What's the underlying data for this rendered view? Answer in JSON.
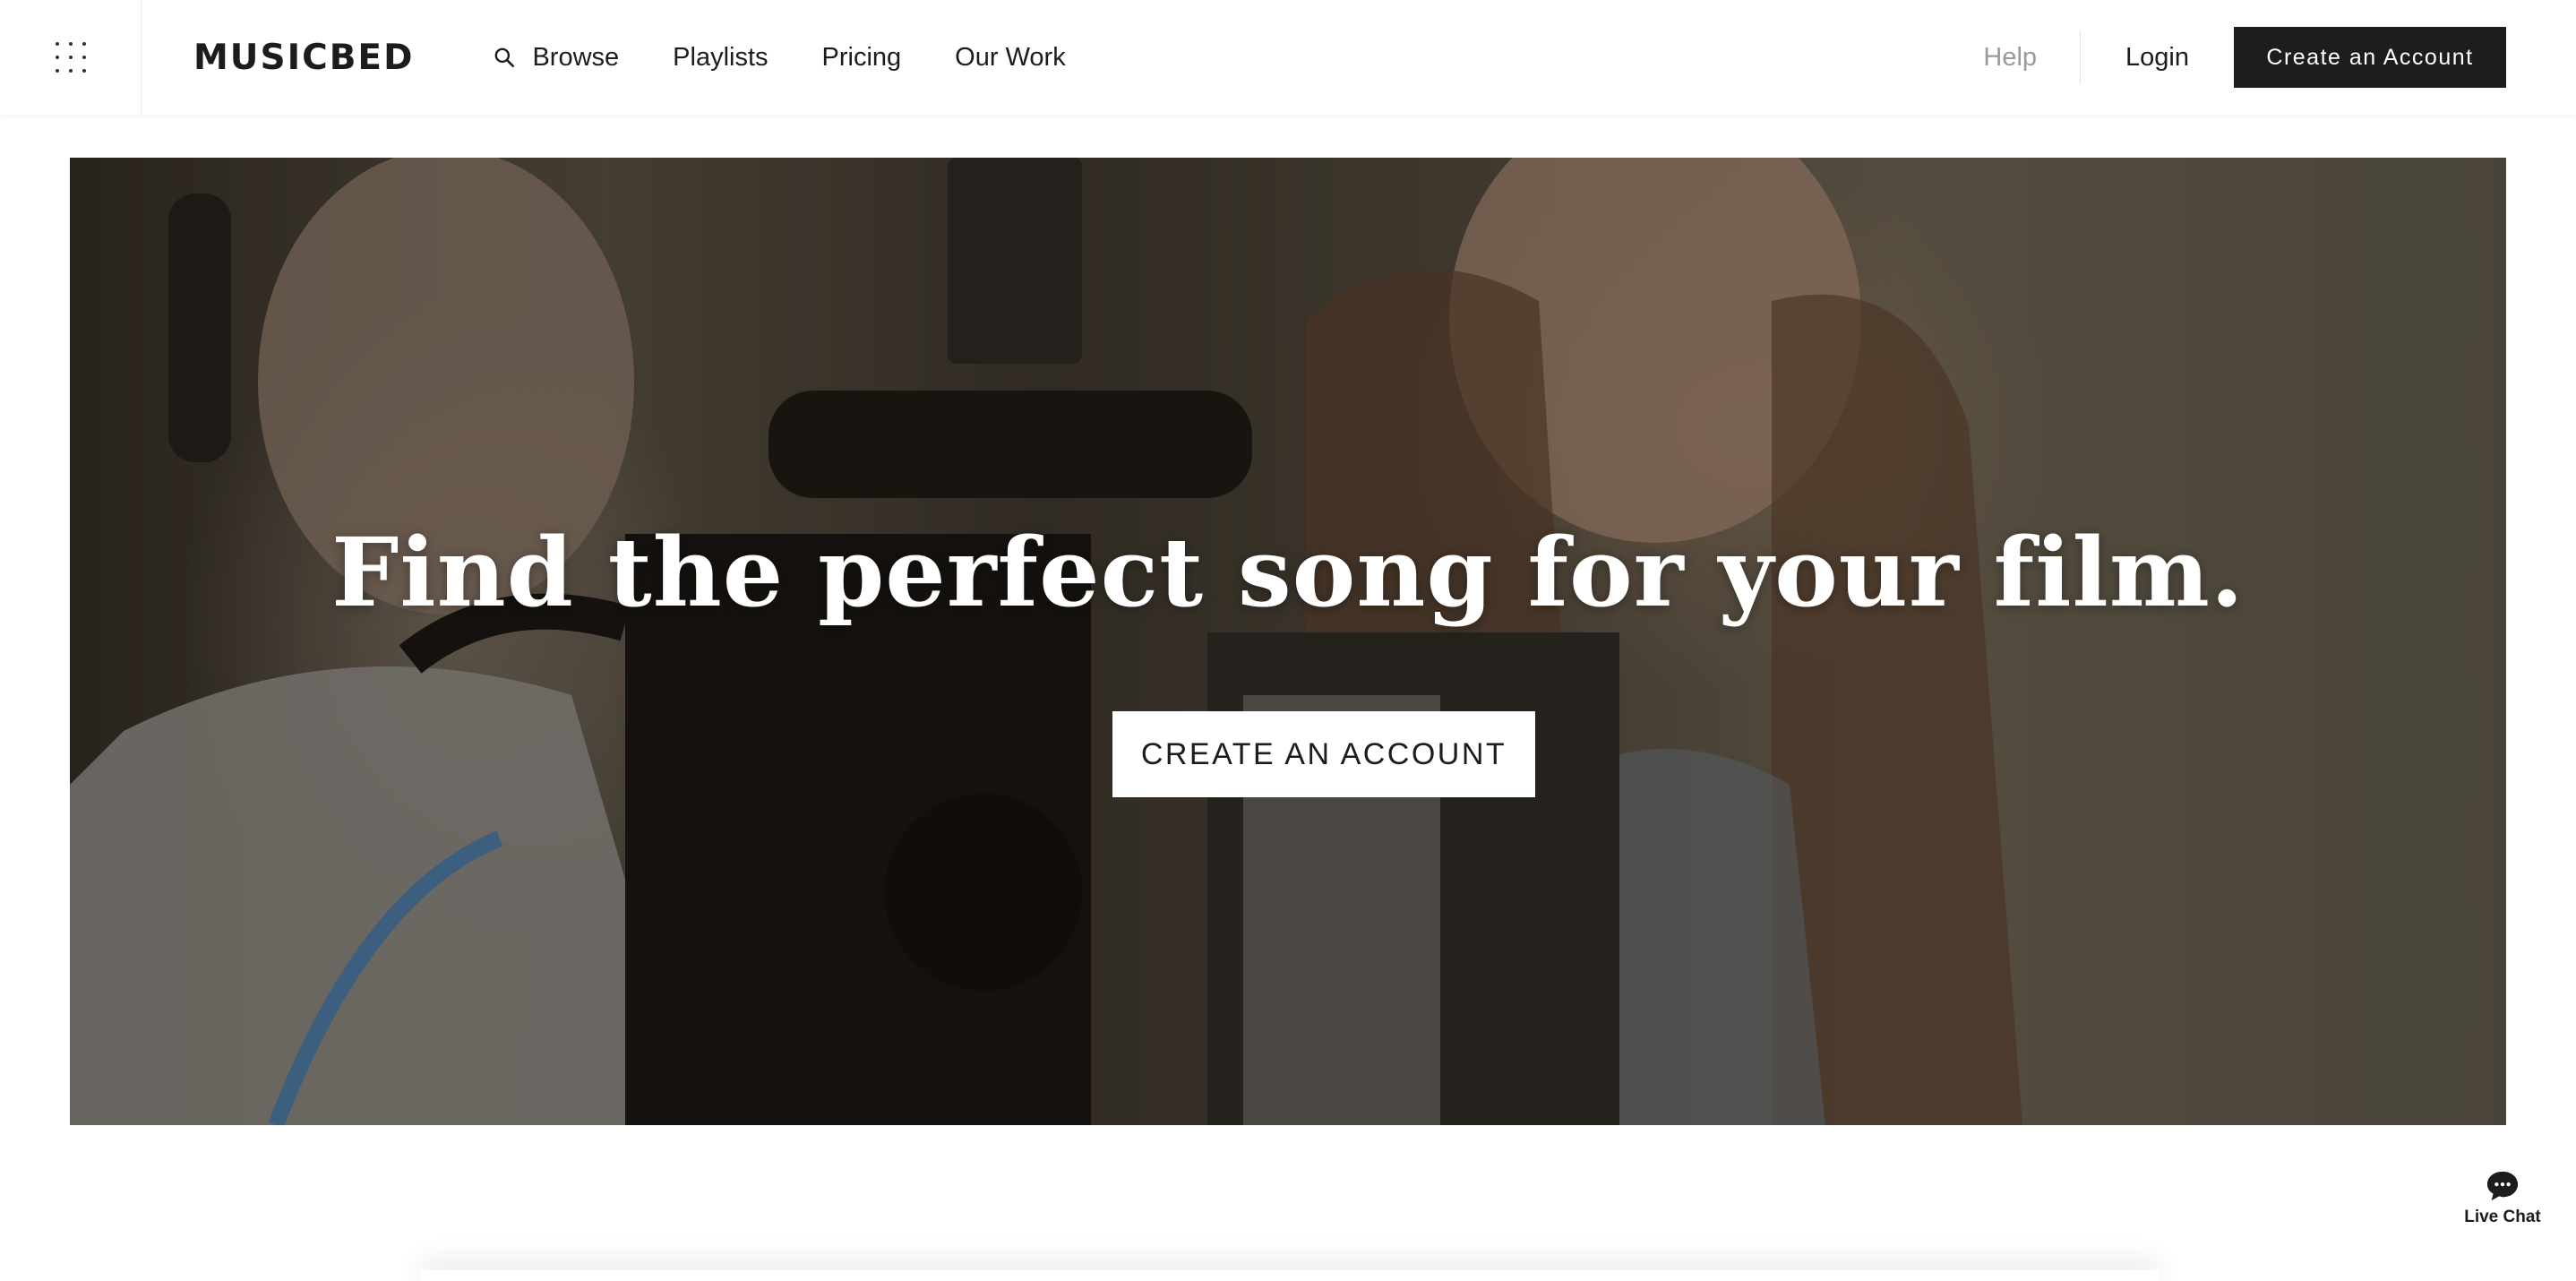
{
  "brand": {
    "logo_text": "MUSICBED"
  },
  "nav": {
    "links": [
      "Browse",
      "Playlists",
      "Pricing",
      "Our Work"
    ],
    "help": "Help",
    "login": "Login",
    "create_account": "Create an Account"
  },
  "hero": {
    "headline": "Find the perfect song for your film.",
    "cta": "CREATE AN ACCOUNT"
  },
  "live_chat": {
    "label": "Live Chat"
  },
  "icons": {
    "menu": "grid-menu-icon",
    "search": "search-icon",
    "chat": "chat-bubble-icon"
  },
  "colors": {
    "primary_button": "#1d1d1d",
    "muted_text": "#9a9a9a",
    "hero_cta_bg": "#ffffff"
  }
}
